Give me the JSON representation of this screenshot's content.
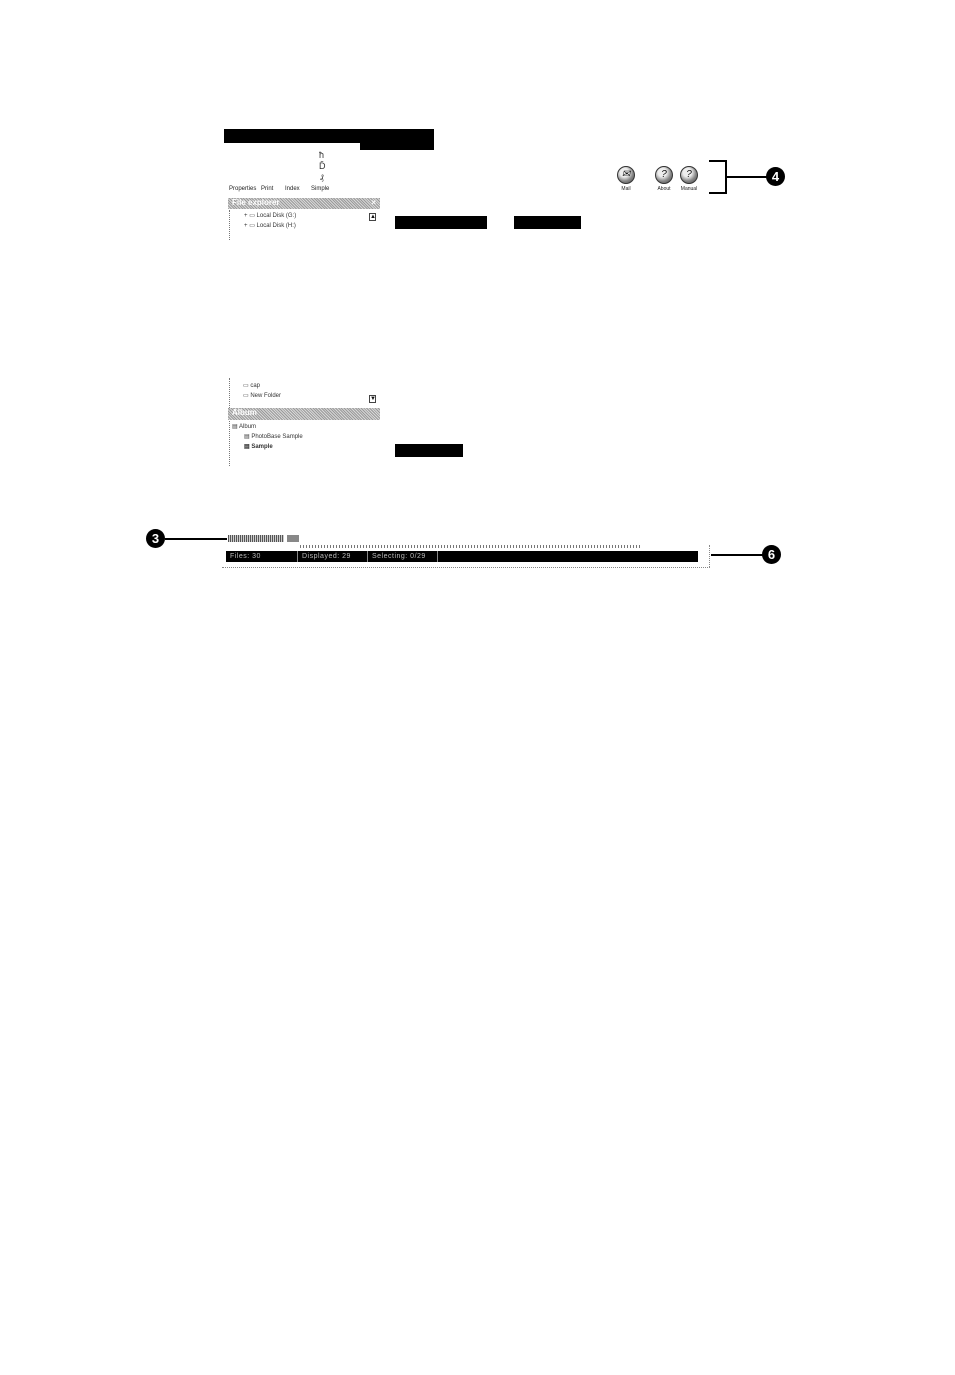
{
  "toolbar": {
    "items": [
      {
        "label": "Properties"
      },
      {
        "label": "Print"
      },
      {
        "label": "Index"
      },
      {
        "label": "Simple"
      }
    ]
  },
  "file_explorer": {
    "title": "File explorer",
    "close": "×",
    "drives": [
      "Local Disk (G:)",
      "Local Disk (H:)"
    ],
    "folders": [
      "cap",
      "New Folder"
    ]
  },
  "album_panel": {
    "title": "Album",
    "items": [
      "Album",
      "PhotoBase Sample",
      "Sample"
    ]
  },
  "right_buttons": [
    {
      "label": "Mail",
      "icon": "mail-icon"
    },
    {
      "label": "About",
      "icon": "about-icon"
    },
    {
      "label": "Manual",
      "icon": "manual-icon"
    }
  ],
  "callouts": {
    "four": "4",
    "three": "3",
    "six": "6"
  },
  "status_bar": {
    "files": "Files: 30",
    "displayed": "Displayed: 29",
    "selecting": "Selecting: 0/29"
  }
}
